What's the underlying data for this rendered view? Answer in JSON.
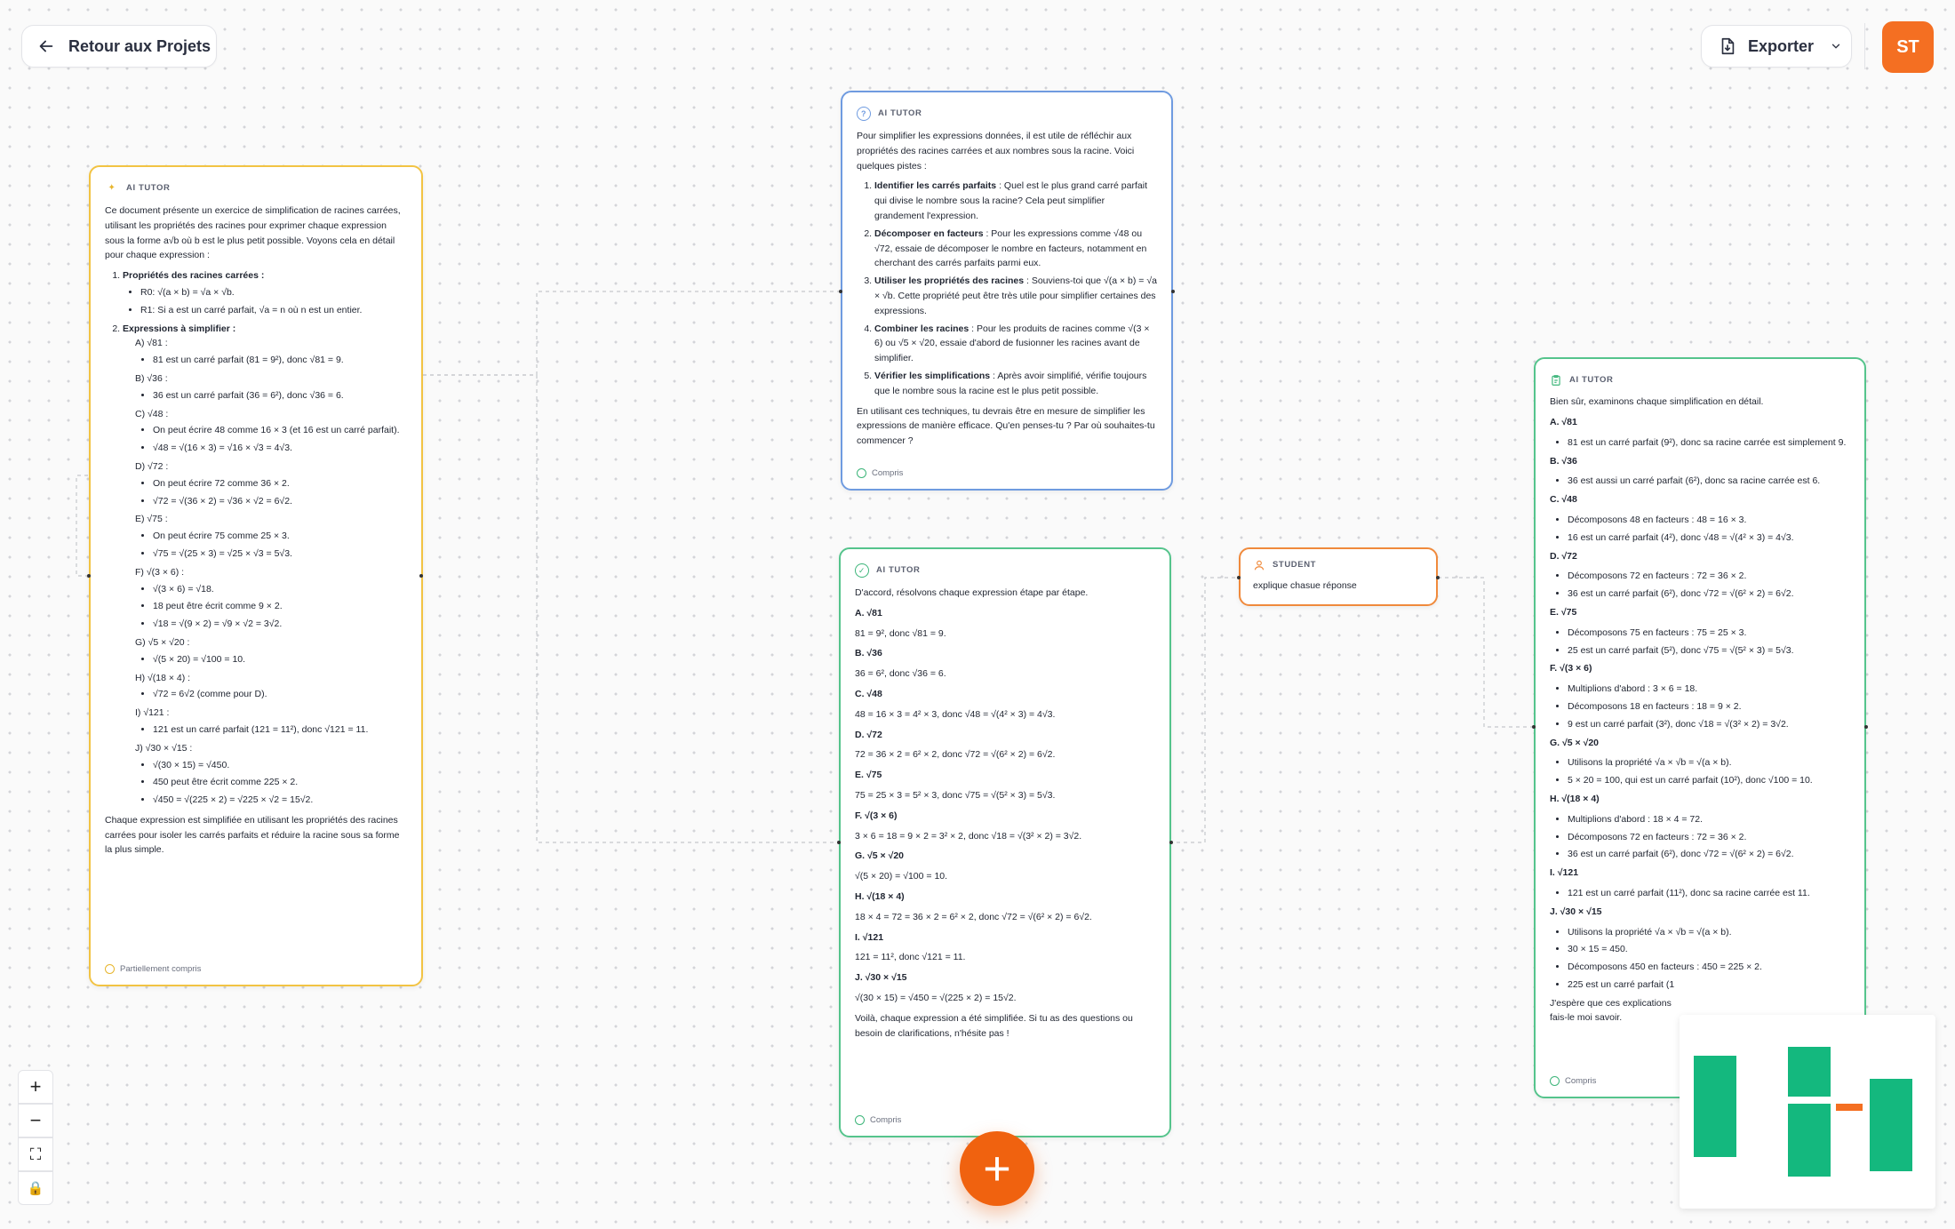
{
  "header": {
    "back_label": "Retour aux Projets",
    "export_label": "Exporter",
    "avatar_initials": "ST"
  },
  "colors": {
    "accent_orange": "#F46F22",
    "ai_yellow": "#F2C343",
    "ai_blue": "#6F9BE0",
    "ai_green": "#55C48C",
    "student_orange": "#F08A3C"
  },
  "cards": {
    "left": {
      "badge": "AI TUTOR",
      "intro": "Ce document présente un exercice de simplification de racines carrées, utilisant les propriétés des racines pour exprimer chaque expression sous la forme a√b où b est le plus petit possible. Voyons cela en détail pour chaque expression :",
      "s1_title": "Propriétés des racines carrées :",
      "s1_items": [
        "R0: √(a × b) = √a × √b.",
        "R1: Si a est un carré parfait, √a = n où n est un entier."
      ],
      "s2_title": "Expressions à simplifier :",
      "exprs": [
        {
          "label": "A) √81 :",
          "items": [
            "81 est un carré parfait (81 = 9²), donc √81 = 9."
          ]
        },
        {
          "label": "B) √36 :",
          "items": [
            "36 est un carré parfait (36 = 6²), donc √36 = 6."
          ]
        },
        {
          "label": "C) √48 :",
          "items": [
            "On peut écrire 48 comme 16 × 3 (et 16 est un carré parfait).",
            "√48 = √(16 × 3) = √16 × √3 = 4√3."
          ]
        },
        {
          "label": "D) √72 :",
          "items": [
            "On peut écrire 72 comme 36 × 2.",
            "√72 = √(36 × 2) = √36 × √2 = 6√2."
          ]
        },
        {
          "label": "E) √75 :",
          "items": [
            "On peut écrire 75 comme 25 × 3.",
            "√75 = √(25 × 3) = √25 × √3 = 5√3."
          ]
        },
        {
          "label": "F) √(3 × 6) :",
          "items": [
            "√(3 × 6) = √18.",
            "18 peut être écrit comme 9 × 2.",
            "√18 = √(9 × 2) = √9 × √2 = 3√2."
          ]
        },
        {
          "label": "G) √5 × √20 :",
          "items": [
            "√(5 × 20) = √100 = 10."
          ]
        },
        {
          "label": "H) √(18 × 4) :",
          "items": [
            "√72 = 6√2 (comme pour D)."
          ]
        },
        {
          "label": "I) √121 :",
          "items": [
            "121 est un carré parfait (121 = 11²), donc √121 = 11."
          ]
        },
        {
          "label": "J) √30 × √15 :",
          "items": [
            "√(30 × 15) = √450.",
            "450 peut être écrit comme 225 × 2.",
            "√450 = √(225 × 2) = √225 × √2 = 15√2."
          ]
        }
      ],
      "conclusion": "Chaque expression est simplifiée en utilisant les propriétés des racines carrées pour isoler les carrés parfaits et réduire la racine sous sa forme la plus simple.",
      "status": "Partiellement compris"
    },
    "top": {
      "badge": "AI TUTOR",
      "intro": "Pour simplifier les expressions données, il est utile de réfléchir aux propriétés des racines carrées et aux nombres sous la racine. Voici quelques pistes :",
      "steps": [
        {
          "title": "Identifier les carrés parfaits",
          "text": " : Quel est le plus grand carré parfait qui divise le nombre sous la racine? Cela peut simplifier grandement l'expression."
        },
        {
          "title": "Décomposer en facteurs",
          "text": " : Pour les expressions comme √48 ou √72, essaie de décomposer le nombre en facteurs, notamment en cherchant des carrés parfaits parmi eux."
        },
        {
          "title": "Utiliser les propriétés des racines",
          "text": " : Souviens-toi que √(a × b) = √a × √b. Cette propriété peut être très utile pour simplifier certaines des expressions."
        },
        {
          "title": "Combiner les racines",
          "text": " : Pour les produits de racines comme √(3 × 6) ou √5 × √20, essaie d'abord de fusionner les racines avant de simplifier."
        },
        {
          "title": "Vérifier les simplifications",
          "text": " : Après avoir simplifié, vérifie toujours que le nombre sous la racine est le plus petit possible."
        }
      ],
      "outro": "En utilisant ces techniques, tu devrais être en mesure de simplifier les expressions de manière efficace. Qu'en penses-tu ? Par où souhaites-tu commencer ?",
      "status": "Compris"
    },
    "middle": {
      "badge": "AI TUTOR",
      "intro": "D'accord, résolvons chaque expression étape par étape.",
      "items": [
        {
          "label": "A. √81",
          "text": "81 = 9², donc √81 = 9."
        },
        {
          "label": "B. √36",
          "text": "36 = 6², donc √36 = 6."
        },
        {
          "label": "C. √48",
          "text": "48 = 16 × 3 = 4² × 3, donc √48 = √(4² × 3) = 4√3."
        },
        {
          "label": "D. √72",
          "text": "72 = 36 × 2 = 6² × 2, donc √72 = √(6² × 2) = 6√2."
        },
        {
          "label": "E. √75",
          "text": "75 = 25 × 3 = 5² × 3, donc √75 = √(5² × 3) = 5√3."
        },
        {
          "label": "F. √(3 × 6)",
          "text": "3 × 6 = 18 = 9 × 2 = 3² × 2, donc √18 = √(3² × 2) = 3√2."
        },
        {
          "label": "G. √5 × √20",
          "text": "√(5 × 20) = √100 = 10."
        },
        {
          "label": "H. √(18 × 4)",
          "text": "18 × 4 = 72 = 36 × 2 = 6² × 2, donc √72 = √(6² × 2) = 6√2."
        },
        {
          "label": "I. √121",
          "text": "121 = 11², donc √121 = 11."
        },
        {
          "label": "J. √30 × √15",
          "text": "√(30 × 15) = √450 = √(225 × 2) = 15√2."
        }
      ],
      "outro": "Voilà, chaque expression a été simplifiée. Si tu as des questions ou besoin de clarifications, n'hésite pas !",
      "status": "Compris"
    },
    "student": {
      "badge": "STUDENT",
      "text": "explique chasue réponse"
    },
    "right": {
      "badge": "AI TUTOR",
      "intro": "Bien sûr, examinons chaque simplification en détail.",
      "items": [
        {
          "label": "A. √81",
          "bullets": [
            "81 est un carré parfait (9²), donc sa racine carrée est simplement 9."
          ]
        },
        {
          "label": "B. √36",
          "bullets": [
            "36 est aussi un carré parfait (6²), donc sa racine carrée est 6."
          ]
        },
        {
          "label": "C. √48",
          "bullets": [
            "Décomposons 48 en facteurs : 48 = 16 × 3.",
            "16 est un carré parfait (4²), donc √48 = √(4² × 3) = 4√3."
          ]
        },
        {
          "label": "D. √72",
          "bullets": [
            "Décomposons 72 en facteurs : 72 = 36 × 2.",
            "36 est un carré parfait (6²), donc √72 = √(6² × 2) = 6√2."
          ]
        },
        {
          "label": "E. √75",
          "bullets": [
            "Décomposons 75 en facteurs : 75 = 25 × 3.",
            "25 est un carré parfait (5²), donc √75 = √(5² × 3) = 5√3."
          ]
        },
        {
          "label": "F. √(3 × 6)",
          "bullets": [
            "Multiplions d'abord : 3 × 6 = 18.",
            "Décomposons 18 en facteurs : 18 = 9 × 2.",
            "9 est un carré parfait (3²), donc √18 = √(3² × 2) = 3√2."
          ]
        },
        {
          "label": "G. √5 × √20",
          "bullets": [
            "Utilisons la propriété √a × √b = √(a × b).",
            "5 × 20 = 100, qui est un carré parfait (10²), donc √100 = 10."
          ]
        },
        {
          "label": "H. √(18 × 4)",
          "bullets": [
            "Multiplions d'abord : 18 × 4 = 72.",
            "Décomposons 72 en facteurs : 72 = 36 × 2.",
            "36 est un carré parfait (6²), donc √72 = √(6² × 2) = 6√2."
          ]
        },
        {
          "label": "I. √121",
          "bullets": [
            "121 est un carré parfait (11²), donc sa racine carrée est 11."
          ]
        },
        {
          "label": "J. √30 × √15",
          "bullets": [
            "Utilisons la propriété √a × √b = √(a × b).",
            "30 × 15 = 450.",
            "Décomposons 450 en facteurs : 450 = 225 × 2.",
            "225 est un carré parfait (1"
          ]
        }
      ],
      "outro": "J'espère que ces explications",
      "outro2": "fais-le moi savoir.",
      "status": "Compris"
    }
  },
  "controls": {
    "zoom_in": "+",
    "zoom_out": "−",
    "fit": "⛶",
    "lock": "🔒",
    "add": "+"
  }
}
